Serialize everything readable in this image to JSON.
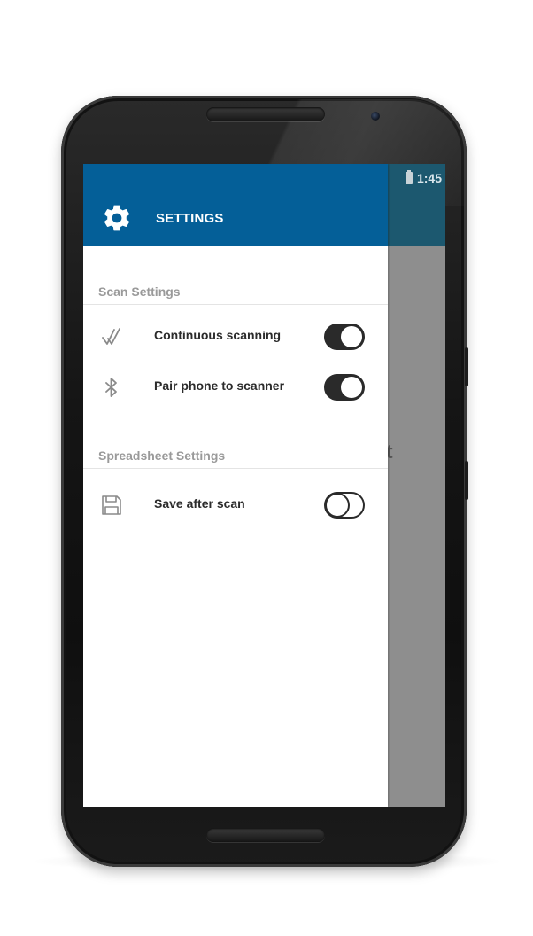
{
  "status_bar": {
    "time": "1:45",
    "battery_icon": "battery-icon"
  },
  "background": {
    "partial_text": "et"
  },
  "drawer": {
    "header": {
      "icon": "gear-icon",
      "title": "SETTINGS"
    },
    "sections": [
      {
        "title": "Scan Settings",
        "items": [
          {
            "icon": "double-check-icon",
            "label": "Continuous scanning",
            "enabled": true
          },
          {
            "icon": "bluetooth-icon",
            "label": "Pair phone to scanner",
            "enabled": true
          }
        ]
      },
      {
        "title": "Spreadsheet Settings",
        "items": [
          {
            "icon": "floppy-disk-icon",
            "label": "Save after scan",
            "enabled": false
          }
        ]
      }
    ]
  },
  "colors": {
    "drawer_header": "#045f98",
    "app_bar": "#1c586f",
    "toggle": "#2a2a2a",
    "scrim": "#8e8e8e"
  }
}
